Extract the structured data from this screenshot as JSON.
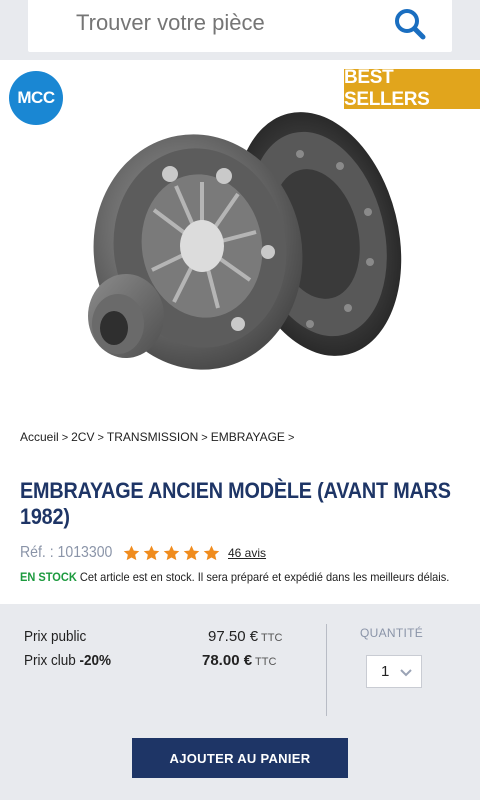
{
  "search": {
    "placeholder": "Trouver votre pièce"
  },
  "hero": {
    "brand_logo_text": "MCC",
    "badge": "BEST SELLERS"
  },
  "breadcrumb": {
    "items": [
      "Accueil",
      "2CV",
      "TRANSMISSION",
      "EMBRAYAGE"
    ],
    "separator": ">"
  },
  "product": {
    "title": "EMBRAYAGE ANCIEN MODÈLE (AVANT MARS 1982)",
    "ref": "Réf. : 1013300",
    "rating": 5,
    "reviews": "46 avis",
    "stock_badge": "EN STOCK",
    "stock_text": "Cet article est en stock. Il sera préparé et expédié dans les meilleurs délais."
  },
  "pricing": {
    "public_label": "Prix public",
    "public_value": "97.50 €",
    "club_label_prefix": "Prix club ",
    "club_discount": "-20%",
    "club_value": "78.00 €",
    "tax_suffix": "TTC"
  },
  "quantity": {
    "label": "QUANTITÉ",
    "value": "1"
  },
  "cart": {
    "button_label": "AJOUTER AU PANIER"
  },
  "colors": {
    "navy": "#1e3566",
    "badge": "#e1a51c",
    "logo": "#1a87d3",
    "stock": "#1c9a3e",
    "star": "#f08c1e"
  },
  "icons": {
    "search": "search-icon",
    "star": "star-icon",
    "chevron": "chevron-down-icon"
  }
}
